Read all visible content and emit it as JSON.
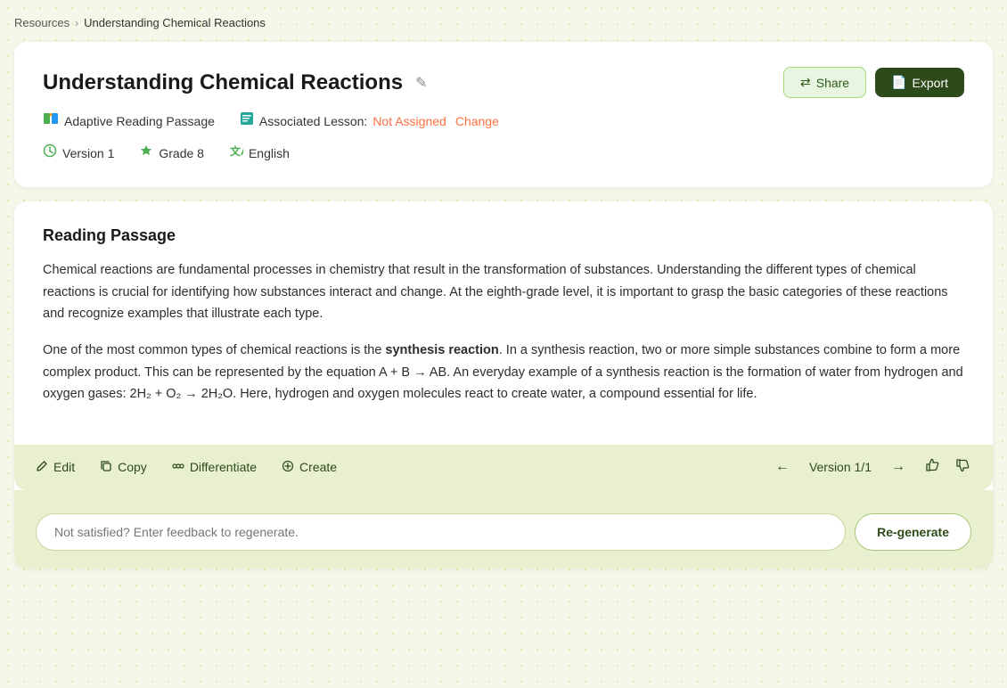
{
  "breadcrumb": {
    "resources": "Resources",
    "chevron": "›",
    "current": "Understanding Chemical Reactions"
  },
  "header": {
    "title": "Understanding Chemical Reactions",
    "edit_icon": "✎",
    "share_label": "Share",
    "export_label": "Export",
    "meta": {
      "type_icon": "🧩",
      "type_label": "Adaptive Reading Passage",
      "lesson_icon": "📋",
      "lesson_label": "Associated Lesson:",
      "lesson_status": "Not Assigned",
      "change_label": "Change",
      "version_icon": "🕐",
      "version_label": "Version 1",
      "grade_icon": "🎓",
      "grade_label": "Grade 8",
      "language_icon": "🔤",
      "language_label": "English"
    }
  },
  "reading": {
    "title": "Reading Passage",
    "paragraph1": "Chemical reactions are fundamental processes in chemistry that result in the transformation of substances. Understanding the different types of chemical reactions is crucial for identifying how substances interact and change. At the eighth-grade level, it is important to grasp the basic categories of these reactions and recognize examples that illustrate each type.",
    "paragraph2_pre": "One of the most common types of chemical reactions is the ",
    "paragraph2_bold": "synthesis reaction",
    "paragraph2_post": ". In a synthesis reaction, two or more simple substances combine to form a more complex product. This can be represented by the equation A + B → AB. An everyday example of a synthesis reaction is the formation of water from hydrogen and oxygen gases: 2H₂ + O₂ → 2H₂O. Here, hydrogen and oxygen molecules react to create water, a compound essential for life."
  },
  "toolbar": {
    "edit_label": "Edit",
    "copy_label": "Copy",
    "differentiate_label": "Differentiate",
    "create_label": "Create",
    "version_label": "Version 1/1",
    "thumbup_icon": "👍",
    "thumbdown_icon": "👎"
  },
  "feedback": {
    "placeholder": "Not satisfied? Enter feedback to regenerate.",
    "regenerate_label": "Re-generate"
  }
}
